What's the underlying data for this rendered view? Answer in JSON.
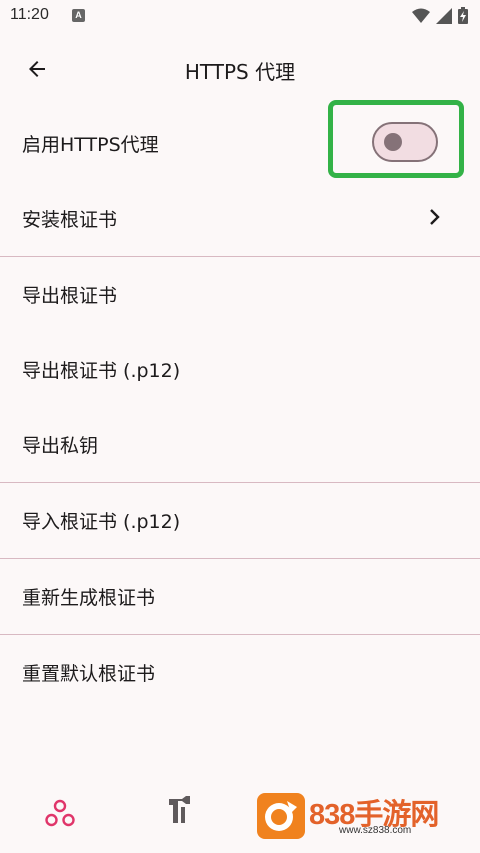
{
  "status_bar": {
    "time": "11:20",
    "notification_icon": "A"
  },
  "header": {
    "title": "HTTPS 代理",
    "back_icon": "arrow-left-icon"
  },
  "settings": {
    "items": [
      {
        "label": "启用HTTPS代理",
        "control": "toggle",
        "enabled": false
      },
      {
        "label": "安装根证书",
        "control": "chevron"
      },
      {
        "label": "导出根证书"
      },
      {
        "label": "导出根证书 (.p12)"
      },
      {
        "label": "导出私钥"
      },
      {
        "label": "导入根证书 (.p12)"
      },
      {
        "label": "重新生成根证书"
      },
      {
        "label": "重置默认根证书"
      }
    ]
  },
  "bottom_nav": {
    "items": [
      {
        "icon": "home-dots-icon",
        "active": true
      },
      {
        "icon": "tools-icon",
        "active": false
      }
    ]
  },
  "watermark": {
    "brand": "838手游网",
    "url": "www.sz838.com"
  },
  "colors": {
    "accent": "#e0356a",
    "highlight": "#33b247",
    "divider": "#d8b9c2",
    "background": "#fcf8f8"
  }
}
